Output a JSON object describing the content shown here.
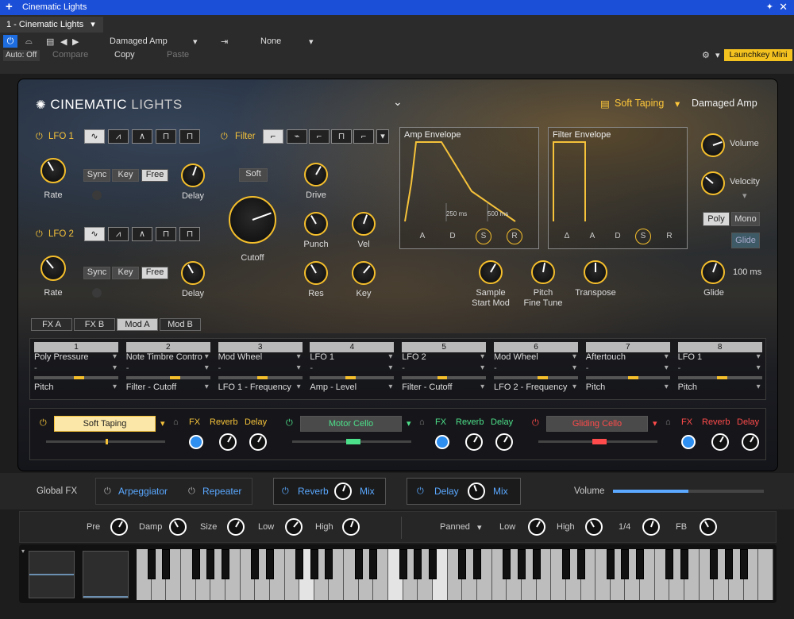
{
  "window": {
    "title": "Cinematic Lights",
    "pin": "📌",
    "close": "✕"
  },
  "host": {
    "tab": "1 - Cinematic Lights",
    "preset": "Damaged Amp",
    "routing": "None",
    "auto": "Auto: Off",
    "compare": "Compare",
    "copy": "Copy",
    "paste": "Paste",
    "device": "Launchkey Mini"
  },
  "plugin": {
    "logo_a": "CINEMATIC",
    "logo_b": "LIGHTS",
    "preset_group": "Soft Taping",
    "preset_name": "Damaged Amp"
  },
  "lfo1": {
    "label": "LFO 1",
    "rate": "Rate",
    "delay": "Delay",
    "sync": "Sync",
    "key": "Key",
    "free": "Free"
  },
  "lfo2": {
    "label": "LFO 2",
    "rate": "Rate",
    "delay": "Delay",
    "sync": "Sync",
    "key": "Key",
    "free": "Free"
  },
  "filter": {
    "label": "Filter",
    "soft": "Soft",
    "cutoff": "Cutoff",
    "drive": "Drive",
    "punch": "Punch",
    "vel": "Vel",
    "res": "Res",
    "key": "Key"
  },
  "amp_env": {
    "title": "Amp Envelope",
    "t1": "250 ms",
    "t2": "500 ms",
    "btns": [
      "A",
      "D",
      "S",
      "R"
    ]
  },
  "filter_env": {
    "title": "Filter Envelope",
    "btns": [
      "Δ",
      "A",
      "D",
      "S",
      "R"
    ]
  },
  "right": {
    "volume": "Volume",
    "velocity": "Velocity",
    "poly": "Poly",
    "mono": "Mono",
    "glide_btn": "Glide",
    "glide": "Glide",
    "glide_val": "100 ms"
  },
  "mid": {
    "sample": "Sample",
    "start_mod": "Start Mod",
    "pitch": "Pitch",
    "fine": "Fine Tune",
    "transpose": "Transpose"
  },
  "tabs": [
    "FX A",
    "FX B",
    "Mod A",
    "Mod B"
  ],
  "mod": [
    {
      "n": "1",
      "src": "Poly Pressure",
      "dst": "Pitch",
      "v": 0.55
    },
    {
      "n": "2",
      "src": "Note Timbre Contro",
      "dst": "Filter - Cutoff",
      "v": 0.6
    },
    {
      "n": "3",
      "src": "Mod Wheel",
      "dst": "LFO 1 - Frequency",
      "v": 0.55
    },
    {
      "n": "4",
      "src": "LFO 1",
      "dst": "Amp - Level",
      "v": 0.5
    },
    {
      "n": "5",
      "src": "LFO 2",
      "dst": "Filter - Cutoff",
      "v": 0.5
    },
    {
      "n": "6",
      "src": "Mod Wheel",
      "dst": "LFO 2 - Frequency",
      "v": 0.6
    },
    {
      "n": "7",
      "src": "Aftertouch",
      "dst": "Pitch",
      "v": 0.58
    },
    {
      "n": "8",
      "src": "LFO 1",
      "dst": "Pitch",
      "v": 0.55
    }
  ],
  "layers": [
    {
      "name": "Soft Taping",
      "color": "#f5c23a",
      "fx": "FX",
      "reverb": "Reverb",
      "delay": "Delay"
    },
    {
      "name": "Motor Cello",
      "color": "#4de08a",
      "fx": "FX",
      "reverb": "Reverb",
      "delay": "Delay"
    },
    {
      "name": "Gliding Cello",
      "color": "#ff4b4b",
      "fx": "FX",
      "reverb": "Reverb",
      "delay": "Delay"
    }
  ],
  "global": {
    "label": "Global FX",
    "arp": "Arpeggiator",
    "rep": "Repeater",
    "reverb": "Reverb",
    "mix": "Mix",
    "delay": "Delay",
    "mix2": "Mix",
    "volume": "Volume"
  },
  "fxrow": {
    "pre": "Pre",
    "damp": "Damp",
    "size": "Size",
    "low": "Low",
    "high": "High",
    "panned": "Panned",
    "low2": "Low",
    "high2": "High",
    "div": "1/4",
    "fb": "FB"
  }
}
